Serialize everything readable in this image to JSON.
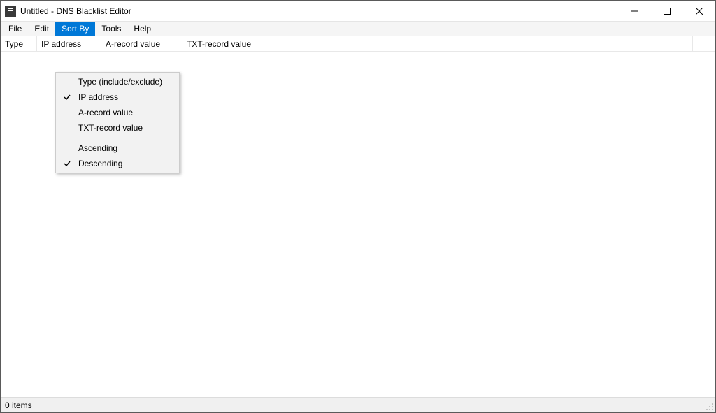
{
  "titlebar": {
    "title": "Untitled - DNS Blacklist Editor"
  },
  "menubar": {
    "file": "File",
    "edit": "Edit",
    "sortby": "Sort By",
    "tools": "Tools",
    "help": "Help"
  },
  "dropdown": {
    "type": "Type (include/exclude)",
    "ip": "IP address",
    "arecord": "A-record value",
    "txtrecord": "TXT-record value",
    "ascending": "Ascending",
    "descending": "Descending"
  },
  "columns": {
    "type": "Type",
    "ip": "IP address",
    "arecord": "A-record value",
    "txtrecord": "TXT-record value"
  },
  "statusbar": {
    "items": "0 items"
  }
}
